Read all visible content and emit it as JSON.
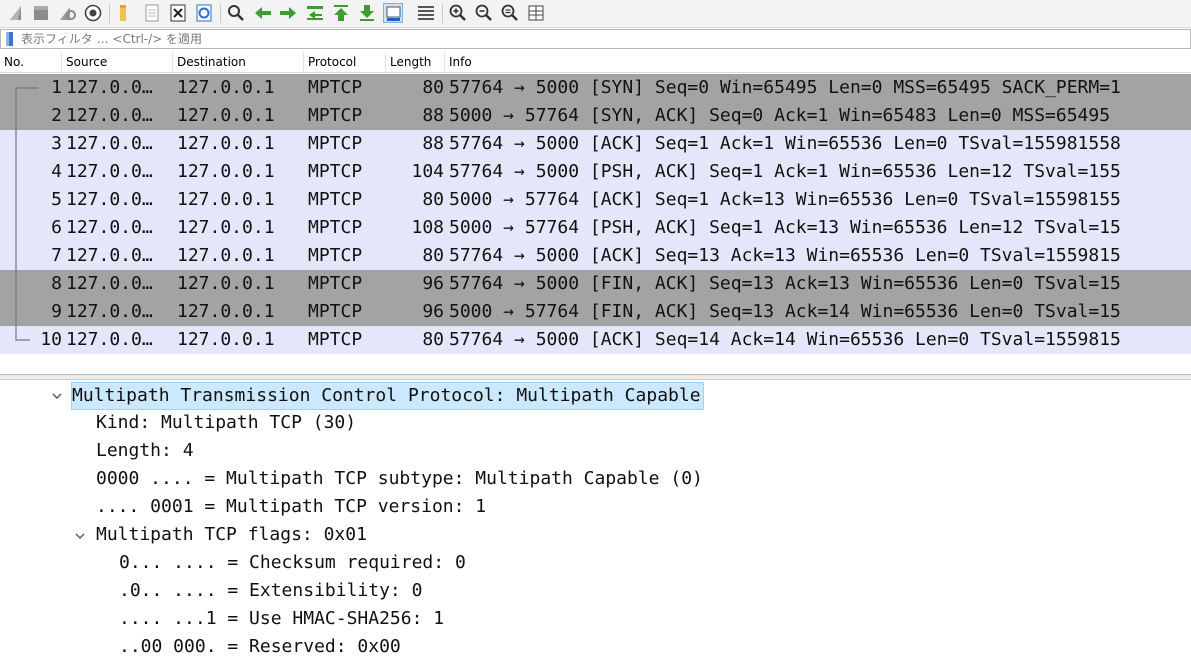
{
  "toolbar": {
    "icons": [
      "shark-fin-start-icon",
      "stop-capture-icon",
      "restart-capture-icon",
      "capture-options-icon",
      "open-file-icon",
      "save-file-icon",
      "close-file-icon",
      "reload-file-icon",
      "find-packet-icon",
      "go-back-icon",
      "go-forward-icon",
      "go-to-packet-icon",
      "go-first-packet-icon",
      "go-last-packet-icon",
      "auto-scroll-icon",
      "colorize-icon",
      "zoom-in-icon",
      "zoom-out-icon",
      "normal-size-icon",
      "resize-columns-icon"
    ]
  },
  "filter": {
    "placeholder": "表示フィルタ … <Ctrl-/> を適用"
  },
  "packet_list": {
    "columns": [
      "No.",
      "Source",
      "Destination",
      "Protocol",
      "Length",
      "Info"
    ],
    "rows": [
      {
        "no": "1",
        "src": "127.0.0…",
        "dst": "127.0.0.1",
        "proto": "MPTCP",
        "len": "80",
        "info": "57764 → 5000 [SYN] Seq=0 Win=65495 Len=0 MSS=65495 SACK_PERM=1",
        "style": "dark"
      },
      {
        "no": "2",
        "src": "127.0.0…",
        "dst": "127.0.0.1",
        "proto": "MPTCP",
        "len": "88",
        "info": "5000 → 57764 [SYN, ACK] Seq=0 Ack=1 Win=65483 Len=0 MSS=65495",
        "style": "dark"
      },
      {
        "no": "3",
        "src": "127.0.0…",
        "dst": "127.0.0.1",
        "proto": "MPTCP",
        "len": "88",
        "info": "57764 → 5000 [ACK] Seq=1 Ack=1 Win=65536 Len=0 TSval=155981558",
        "style": "light"
      },
      {
        "no": "4",
        "src": "127.0.0…",
        "dst": "127.0.0.1",
        "proto": "MPTCP",
        "len": "104",
        "info": "57764 → 5000 [PSH, ACK] Seq=1 Ack=1 Win=65536 Len=12 TSval=155",
        "style": "light"
      },
      {
        "no": "5",
        "src": "127.0.0…",
        "dst": "127.0.0.1",
        "proto": "MPTCP",
        "len": "80",
        "info": "5000 → 57764 [ACK] Seq=1 Ack=13 Win=65536 Len=0 TSval=15598155",
        "style": "light"
      },
      {
        "no": "6",
        "src": "127.0.0…",
        "dst": "127.0.0.1",
        "proto": "MPTCP",
        "len": "108",
        "info": "5000 → 57764 [PSH, ACK] Seq=1 Ack=13 Win=65536 Len=12 TSval=15",
        "style": "light"
      },
      {
        "no": "7",
        "src": "127.0.0…",
        "dst": "127.0.0.1",
        "proto": "MPTCP",
        "len": "80",
        "info": "57764 → 5000 [ACK] Seq=13 Ack=13 Win=65536 Len=0 TSval=1559815",
        "style": "light"
      },
      {
        "no": "8",
        "src": "127.0.0…",
        "dst": "127.0.0.1",
        "proto": "MPTCP",
        "len": "96",
        "info": "57764 → 5000 [FIN, ACK] Seq=13 Ack=13 Win=65536 Len=0 TSval=15",
        "style": "dark"
      },
      {
        "no": "9",
        "src": "127.0.0…",
        "dst": "127.0.0.1",
        "proto": "MPTCP",
        "len": "96",
        "info": "5000 → 57764 [FIN, ACK] Seq=13 Ack=14 Win=65536 Len=0 TSval=15",
        "style": "dark"
      },
      {
        "no": "10",
        "src": "127.0.0…",
        "dst": "127.0.0.1",
        "proto": "MPTCP",
        "len": "80",
        "info": "57764 → 5000 [ACK] Seq=14 Ack=14 Win=65536 Len=0 TSval=1559815",
        "style": "light"
      }
    ]
  },
  "details": {
    "items": [
      {
        "text": "Multipath Transmission Control Protocol: Multipath Capable",
        "indent": 0,
        "expander": "expanded",
        "selected": true
      },
      {
        "text": "Kind: Multipath TCP (30)",
        "indent": 1,
        "expander": "none",
        "selected": false
      },
      {
        "text": "Length: 4",
        "indent": 1,
        "expander": "none",
        "selected": false
      },
      {
        "text": "0000 .... = Multipath TCP subtype: Multipath Capable (0)",
        "indent": 1,
        "expander": "none",
        "selected": false
      },
      {
        "text": ".... 0001 = Multipath TCP version: 1",
        "indent": 1,
        "expander": "none",
        "selected": false
      },
      {
        "text": "Multipath TCP flags: 0x01",
        "indent": 1,
        "expander": "expanded",
        "selected": false
      },
      {
        "text": "0... .... = Checksum required: 0",
        "indent": 2,
        "expander": "none",
        "selected": false
      },
      {
        "text": ".0.. .... = Extensibility: 0",
        "indent": 2,
        "expander": "none",
        "selected": false
      },
      {
        "text": ".... ...1 = Use HMAC-SHA256: 1",
        "indent": 2,
        "expander": "none",
        "selected": false
      },
      {
        "text": "..00 000. = Reserved: 0x00",
        "indent": 2,
        "expander": "none",
        "selected": false
      }
    ]
  },
  "colors": {
    "row_dark": "#a3a3a3",
    "row_light": "#e6e6fa",
    "selection": "#cce8ff",
    "accent_green": "#3f9c35",
    "accent_blue": "#1f5fbf"
  }
}
